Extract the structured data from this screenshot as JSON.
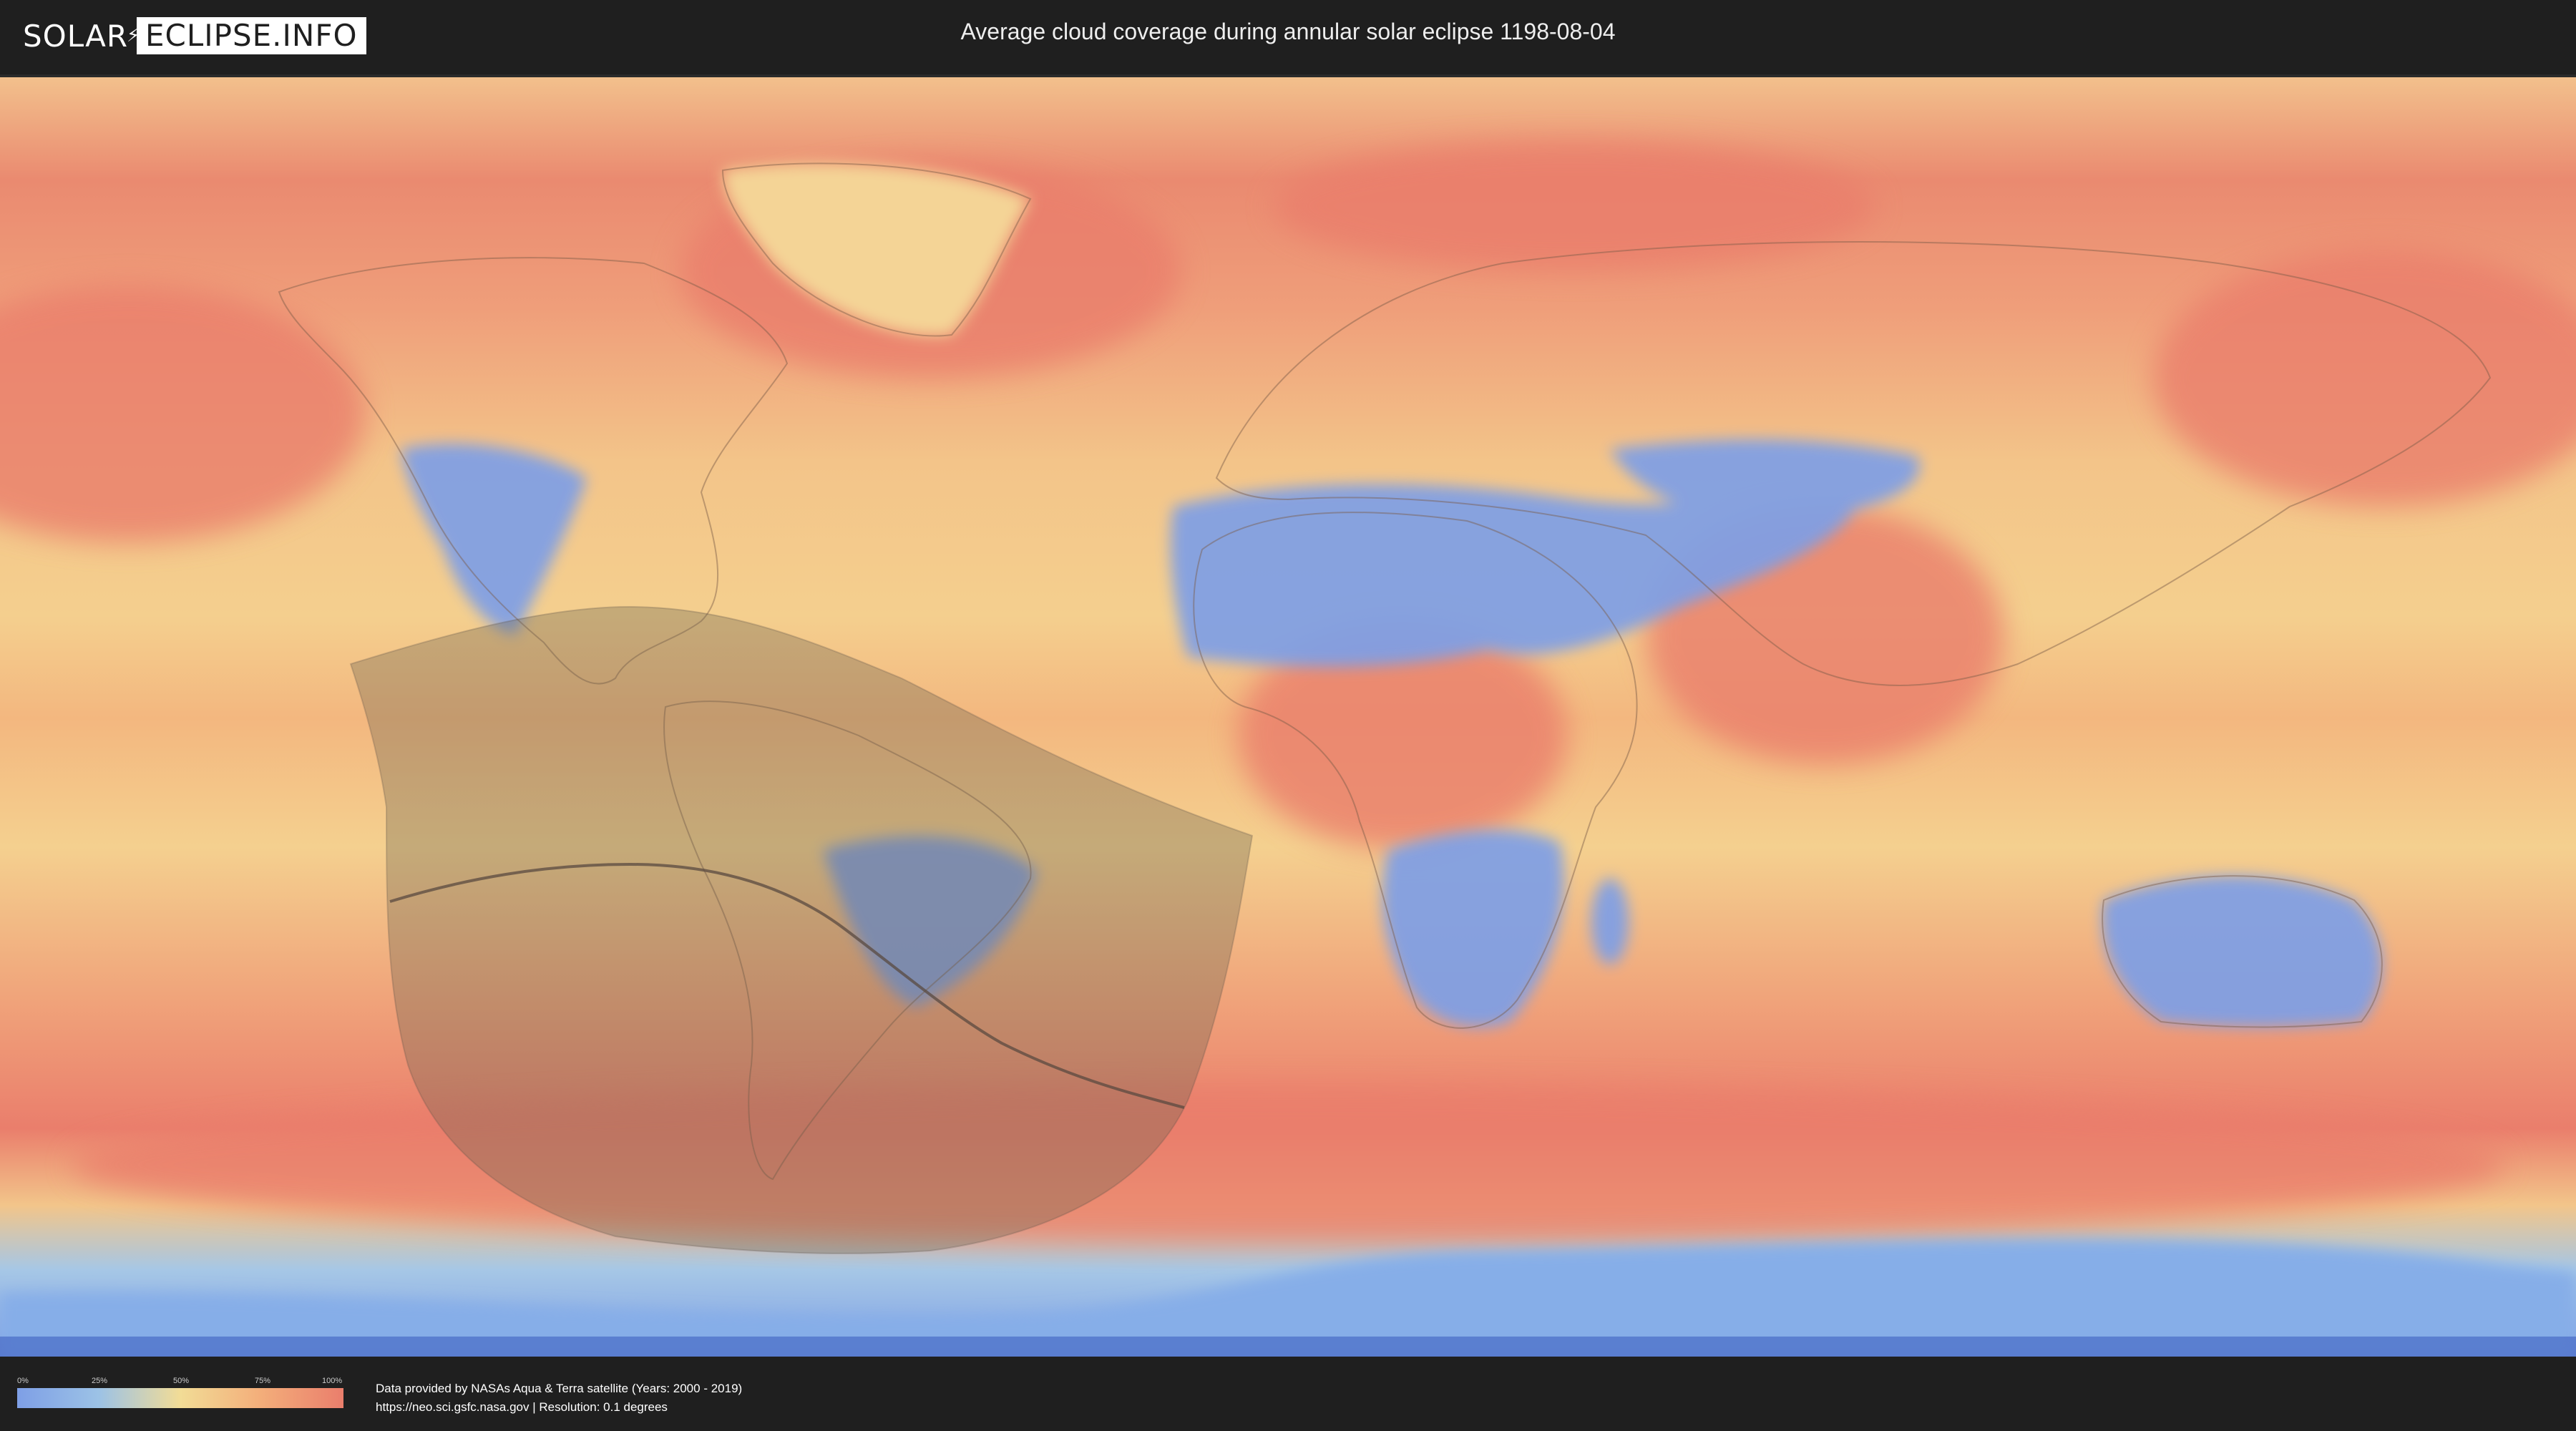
{
  "header": {
    "logo_left": "SOLAR",
    "logo_right": "ECLIPSE.INFO",
    "title": "Average cloud coverage during annular solar eclipse 1198-08-04"
  },
  "map": {
    "colors": {
      "cloudy": "#ea7e6c",
      "clear": "#7e9fe6",
      "ocean_mid": "#f3b47d",
      "ice": "#9cc2e6",
      "eclipse_shadow": "rgba(110,100,80,0.35)",
      "central_line": "#5a4a40"
    }
  },
  "legend": {
    "ticks": [
      "0%",
      "25%",
      "50%",
      "75%",
      "100%"
    ]
  },
  "footer": {
    "credit_line_1": "Data provided by NASAs Aqua & Terra satellite (Years: 2000 - 2019)",
    "credit_line_2": "https://neo.sci.gsfc.nasa.gov | Resolution: 0.1 degrees"
  }
}
